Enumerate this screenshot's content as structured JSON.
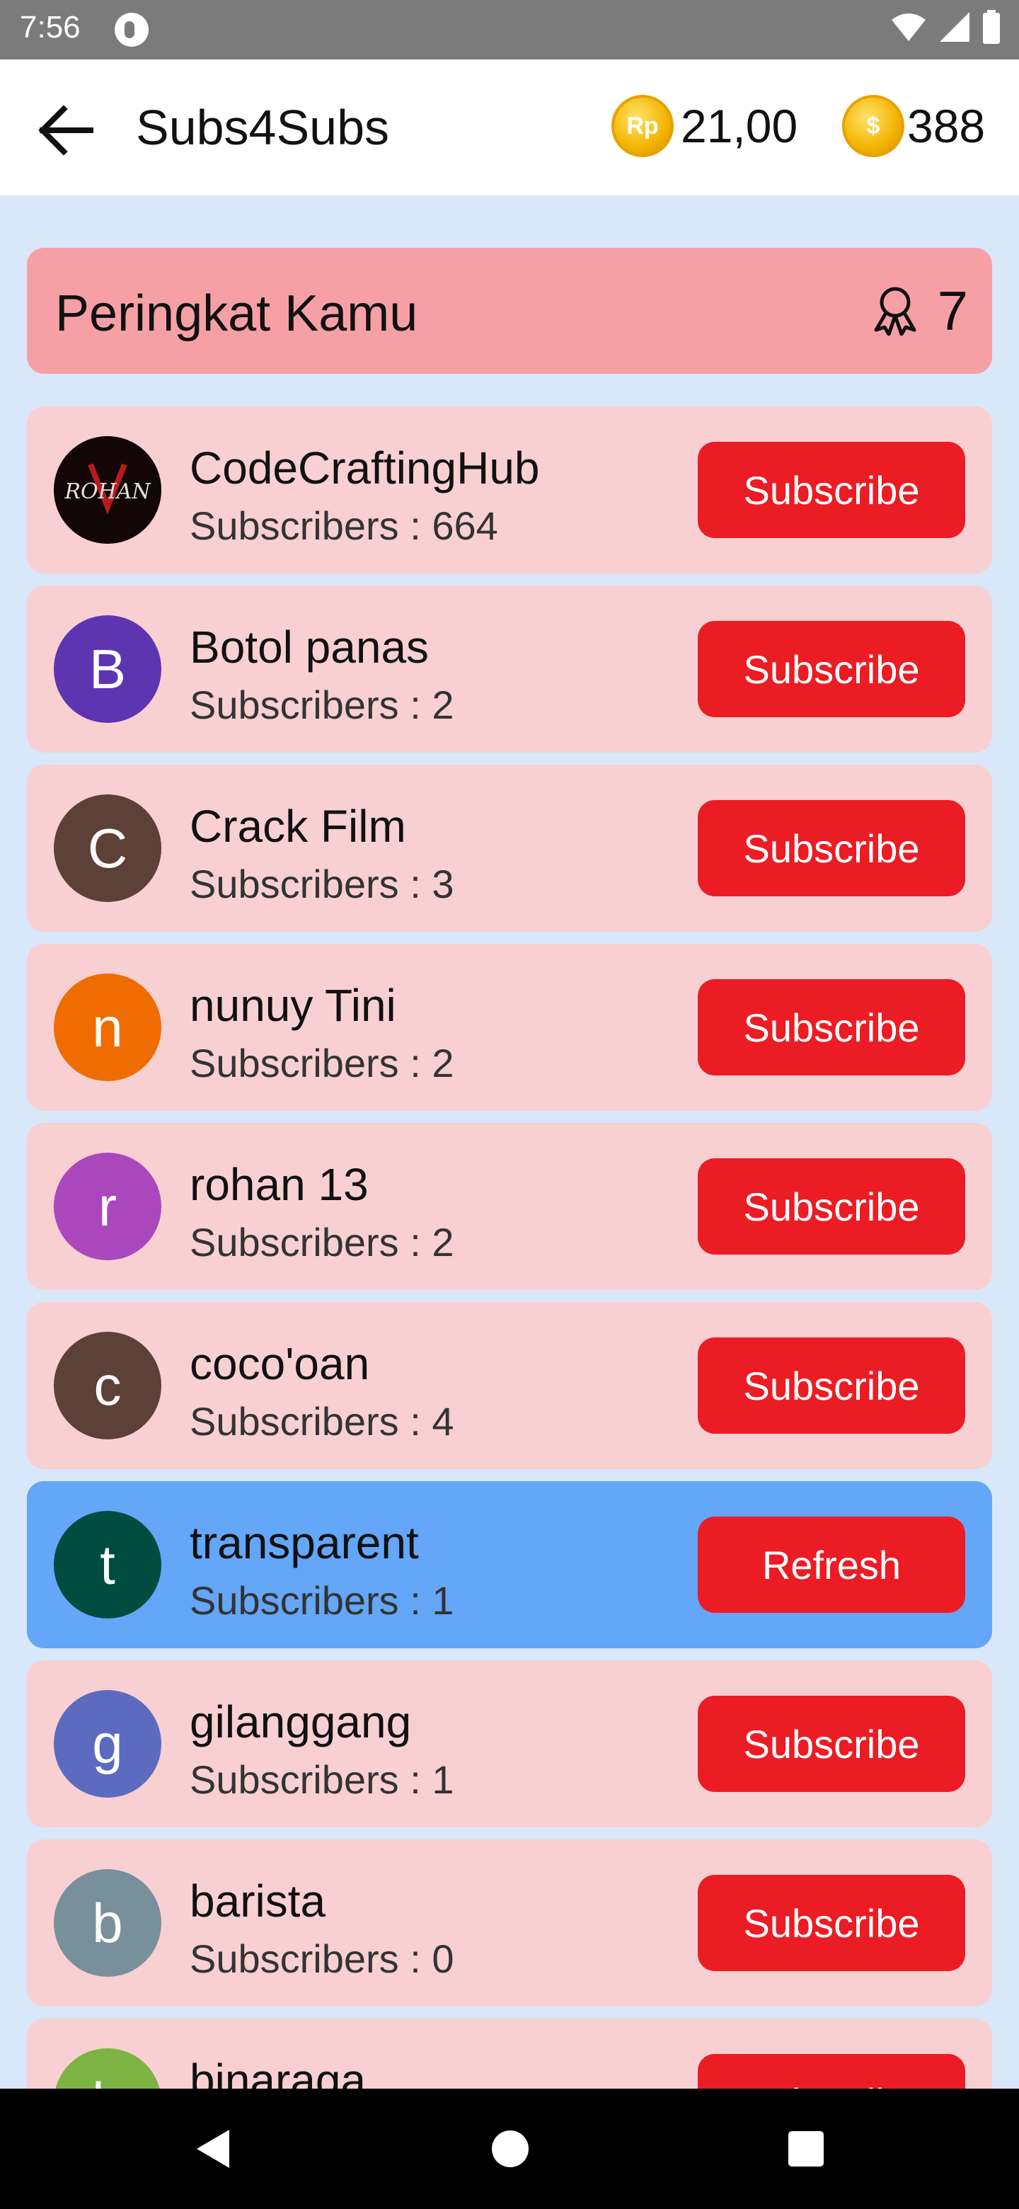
{
  "status_bar": {
    "time": "7:56"
  },
  "app_bar": {
    "title": "Subs4Subs",
    "rp_coin_label": "Rp",
    "rp_balance": "21,00",
    "coin_symbol": "$",
    "coin_balance": "388"
  },
  "rank": {
    "label": "Peringkat Kamu",
    "value": "7"
  },
  "channels": [
    {
      "name": "CodeCraftingHub",
      "subscribers": "Subscribers : 664",
      "action": "Subscribe",
      "avatar_letter": "",
      "avatar_color": "#1a0a0a"
    },
    {
      "name": "Botol panas",
      "subscribers": "Subscribers : 2",
      "action": "Subscribe",
      "avatar_letter": "B",
      "avatar_color": "#5e35b1"
    },
    {
      "name": "Crack Film",
      "subscribers": "Subscribers : 3",
      "action": "Subscribe",
      "avatar_letter": "C",
      "avatar_color": "#5d4037"
    },
    {
      "name": "nunuy Tini",
      "subscribers": "Subscribers : 2",
      "action": "Subscribe",
      "avatar_letter": "n",
      "avatar_color": "#ef6c00"
    },
    {
      "name": "rohan 13",
      "subscribers": "Subscribers : 2",
      "action": "Subscribe",
      "avatar_letter": "r",
      "avatar_color": "#ab47bc"
    },
    {
      "name": "coco'oan",
      "subscribers": "Subscribers : 4",
      "action": "Subscribe",
      "avatar_letter": "c",
      "avatar_color": "#5d4037"
    },
    {
      "name": "transparent",
      "subscribers": "Subscribers : 1",
      "action": "Refresh",
      "avatar_letter": "t",
      "avatar_color": "#004d40"
    },
    {
      "name": "gilanggang",
      "subscribers": "Subscribers : 1",
      "action": "Subscribe",
      "avatar_letter": "g",
      "avatar_color": "#5c6bc0"
    },
    {
      "name": "barista",
      "subscribers": "Subscribers : 0",
      "action": "Subscribe",
      "avatar_letter": "b",
      "avatar_color": "#78909c"
    },
    {
      "name": "binaraga",
      "subscribers": "",
      "action": "Subscribe",
      "avatar_letter": "b",
      "avatar_color": "#7cb342"
    }
  ],
  "colors": {
    "background": "#d9e7fb",
    "rank_card": "#f6a0a6",
    "list_item": "#f8d0d2",
    "list_item_current": "#64a6f8",
    "button": "#ec1c24"
  }
}
